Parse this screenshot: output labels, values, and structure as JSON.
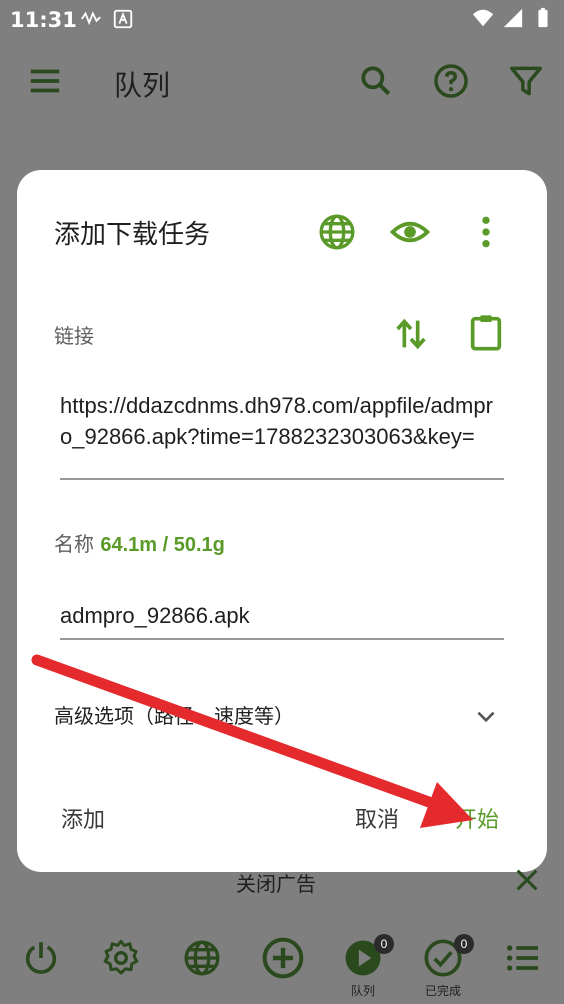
{
  "status_bar": {
    "time": "11:31",
    "left_icons": [
      "signal-activity-icon",
      "accessibility-a-icon"
    ],
    "right_icons": [
      "wifi-icon",
      "cell-signal-icon",
      "battery-icon"
    ]
  },
  "app_bar": {
    "title": "队列",
    "icons": [
      "menu-icon",
      "search-icon",
      "help-icon",
      "filter-icon"
    ]
  },
  "dialog": {
    "title": "添加下载任务",
    "header_icons": [
      "globe-icon",
      "eye-icon",
      "more-vert-icon"
    ],
    "link_label": "链接",
    "link_icons": [
      "swap-vertical-icon",
      "clipboard-icon"
    ],
    "url_value": "https://ddazcdnms.dh978.com/appfile/admpro_92866.apk?time=1788232303063&key=",
    "name_label": "名称",
    "size_info": "64.1m / 50.1g",
    "name_value": "admpro_92866.apk",
    "advanced_label": "高级选项（路径、速度等）",
    "add_button": "添加",
    "cancel_button": "取消",
    "start_button": "开始"
  },
  "ad_bar": {
    "text": "关闭广告"
  },
  "bottom_nav": {
    "items": [
      {
        "icon": "power-icon"
      },
      {
        "icon": "settings-icon"
      },
      {
        "icon": "browser-globe-icon"
      },
      {
        "icon": "add-circle-icon"
      },
      {
        "icon": "play-circle-icon",
        "label": "队列",
        "badge": "0"
      },
      {
        "icon": "check-circle-icon",
        "label": "已完成",
        "badge": "0"
      },
      {
        "icon": "list-icon"
      }
    ]
  },
  "colors": {
    "accent": "#5a9a28",
    "dim_background": "#7f7f7f",
    "arrow": "#e52a2e"
  }
}
